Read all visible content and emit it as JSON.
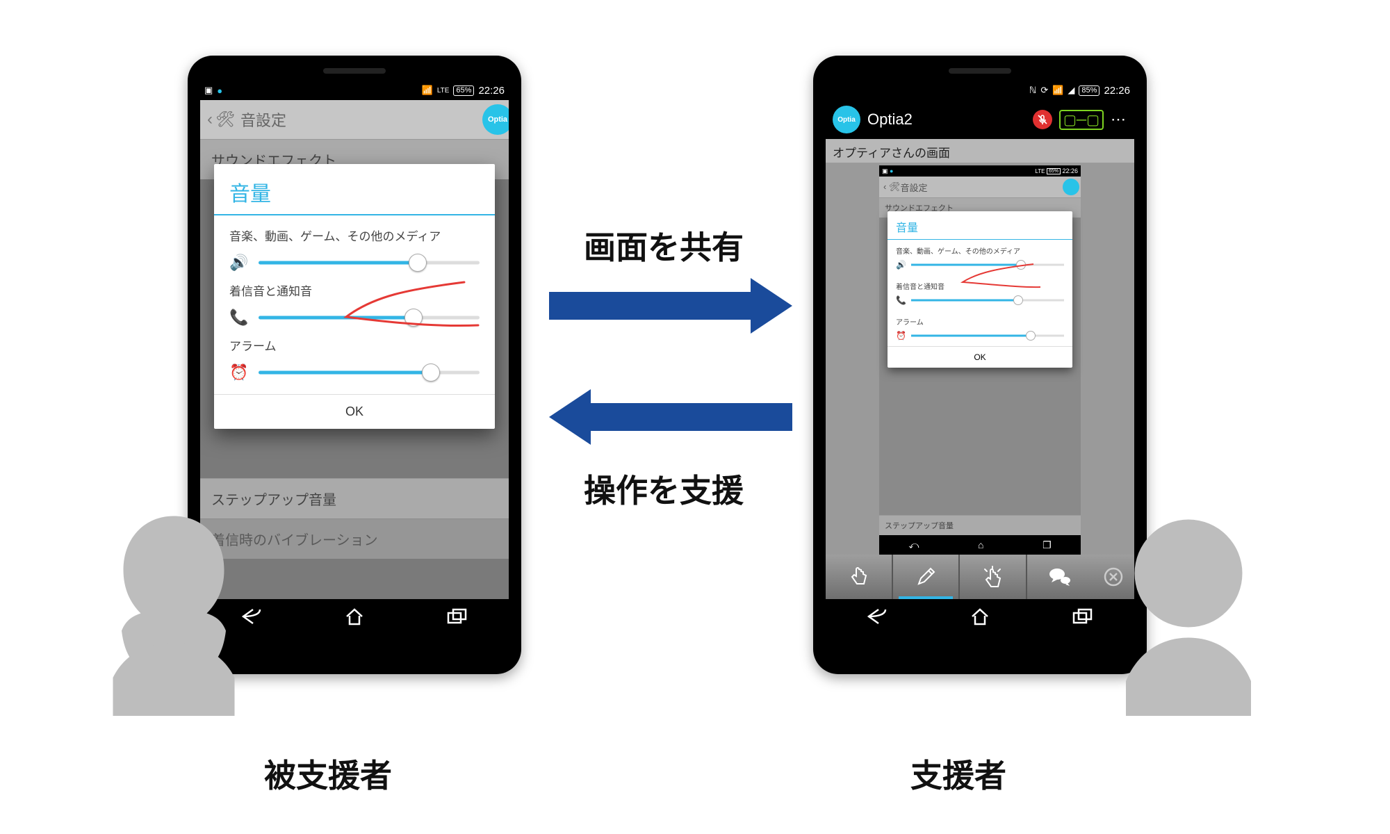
{
  "status": {
    "time": "22:26",
    "battery": "65%",
    "battery2": "85%",
    "signal": "LTE"
  },
  "left_phone": {
    "actionbar_title": "音設定",
    "bg_items": [
      "サウンドエフェクト",
      "ステップアップ音量",
      "着信時のバイブレーション"
    ],
    "dialog": {
      "title": "音量",
      "media_label": "音楽、動画、ゲーム、その他のメディア",
      "ring_label": "着信音と通知音",
      "alarm_label": "アラーム",
      "ok": "OK",
      "sliders": {
        "media": 72,
        "ring": 70,
        "alarm": 78
      }
    }
  },
  "right_phone": {
    "app_title": "Optia2",
    "caption": "オプティアさんの画面",
    "optia_token": "Optia"
  },
  "labels": {
    "share": "画面を共有",
    "assist": "操作を支援",
    "supported": "被支援者",
    "supporter": "支援者"
  },
  "colors": {
    "accent": "#33b5e5",
    "arrow": "#1a4b9b"
  }
}
